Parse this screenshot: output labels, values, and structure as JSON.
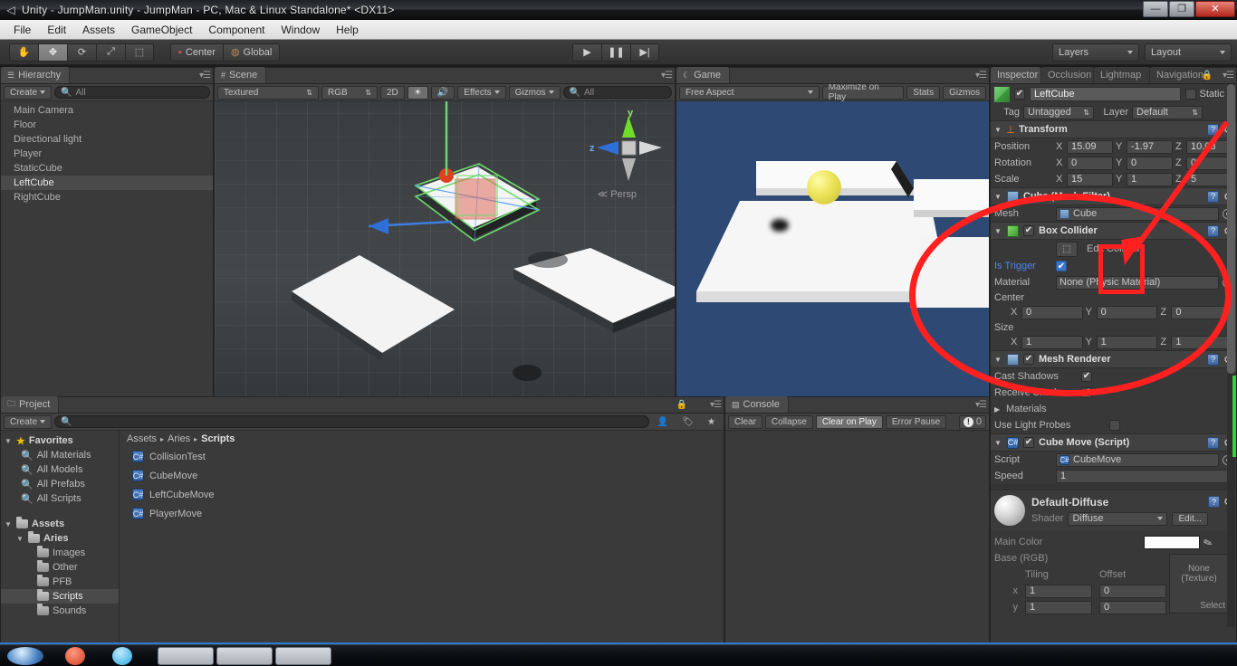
{
  "window": {
    "title": "Unity - JumpMan.unity - JumpMan - PC, Mac & Linux Standalone* <DX11>",
    "minimize": "—",
    "restore": "❐",
    "close": "✕"
  },
  "menubar": {
    "items": [
      "File",
      "Edit",
      "Assets",
      "GameObject",
      "Component",
      "Window",
      "Help"
    ]
  },
  "toolbar": {
    "tools": [
      {
        "name": "hand-tool",
        "glyph": "✋",
        "active": false
      },
      {
        "name": "move-tool",
        "glyph": "✥",
        "active": true
      },
      {
        "name": "rotate-tool",
        "glyph": "⟳",
        "active": false
      },
      {
        "name": "scale-tool",
        "glyph": "⤢",
        "active": false
      },
      {
        "name": "rect-tool",
        "glyph": "⬚",
        "active": false
      }
    ],
    "pivot_label": "Center",
    "space_label": "Global",
    "play": "▶",
    "pause": "❚❚",
    "step": "▶|",
    "layers_label": "Layers",
    "layout_label": "Layout"
  },
  "hierarchy": {
    "tab": "Hierarchy",
    "create_label": "Create",
    "search_placeholder": "All",
    "items": [
      {
        "label": "Main Camera",
        "selected": false
      },
      {
        "label": "Floor",
        "selected": false
      },
      {
        "label": "Directional light",
        "selected": false
      },
      {
        "label": "Player",
        "selected": false
      },
      {
        "label": "StaticCube",
        "selected": false
      },
      {
        "label": "LeftCube",
        "selected": true
      },
      {
        "label": "RightCube",
        "selected": false
      }
    ]
  },
  "scene": {
    "tab": "Scene",
    "draw_mode": "Textured",
    "color_mode": "RGB",
    "two_d": "2D",
    "effects": "Effects",
    "gizmos": "Gizmos",
    "search_placeholder": "All",
    "persp_label": "Persp",
    "axis_y": "y",
    "axis_z": "z"
  },
  "game": {
    "tab": "Game",
    "aspect": "Free Aspect",
    "maximize": "Maximize on Play",
    "stats": "Stats",
    "gizmos": "Gizmos"
  },
  "project": {
    "tab": "Project",
    "create_label": "Create",
    "breadcrumb": [
      "Assets",
      "Aries",
      "Scripts"
    ],
    "favorites_label": "Favorites",
    "favorites": [
      "All Materials",
      "All Models",
      "All Prefabs",
      "All Scripts"
    ],
    "assets_label": "Assets",
    "root_folder": "Aries",
    "folders": [
      {
        "label": "Images",
        "selected": false
      },
      {
        "label": "Other",
        "selected": false
      },
      {
        "label": "PFB",
        "selected": false
      },
      {
        "label": "Scripts",
        "selected": true
      },
      {
        "label": "Sounds",
        "selected": false
      }
    ],
    "assets": [
      "CollisionTest",
      "CubeMove",
      "LeftCubeMove",
      "PlayerMove"
    ],
    "asset_icon": "C#"
  },
  "console": {
    "tab": "Console",
    "clear": "Clear",
    "collapse": "Collapse",
    "clear_on_play": "Clear on Play",
    "error_pause": "Error Pause",
    "error_count": "0"
  },
  "inspector": {
    "tabs": [
      "Inspector",
      "Occlusion",
      "Lightmap",
      "Navigation"
    ],
    "object_name": "LeftCube",
    "object_enabled": true,
    "static_label": "Static",
    "tag_label": "Tag",
    "tag_value": "Untagged",
    "layer_label": "Layer",
    "layer_value": "Default",
    "transform": {
      "title": "Transform",
      "rows": [
        {
          "label": "Position",
          "x": "15.09",
          "y": "-1.97",
          "z": "10.03"
        },
        {
          "label": "Rotation",
          "x": "0",
          "y": "0",
          "z": "0"
        },
        {
          "label": "Scale",
          "x": "15",
          "y": "1",
          "z": "5"
        }
      ]
    },
    "mesh_filter": {
      "title": "Cube (Mesh Filter)",
      "mesh_label": "Mesh",
      "mesh_value": "Cube"
    },
    "box_collider": {
      "title": "Box Collider",
      "enabled": true,
      "edit_collider_label": "Edit Collider",
      "is_trigger_label": "Is Trigger",
      "is_trigger_value": true,
      "material_label": "Material",
      "material_value": "None (Physic Material)",
      "center_label": "Center",
      "center": {
        "x": "0",
        "y": "0",
        "z": "0"
      },
      "size_label": "Size",
      "size": {
        "x": "1",
        "y": "1",
        "z": "1"
      }
    },
    "mesh_renderer": {
      "title": "Mesh Renderer",
      "enabled": true,
      "cast_shadows_label": "Cast Shadows",
      "cast_shadows": true,
      "receive_shadows_label": "Receive Shadows",
      "receive_shadows": true,
      "materials_label": "Materials",
      "use_light_probes_label": "Use Light Probes",
      "use_light_probes": false
    },
    "script_component": {
      "title": "Cube Move (Script)",
      "enabled": true,
      "script_label": "Script",
      "script_value": "CubeMove",
      "speed_label": "Speed",
      "speed_value": "1"
    },
    "material": {
      "title": "Default-Diffuse",
      "shader_label": "Shader",
      "shader_value": "Diffuse",
      "edit_label": "Edit...",
      "main_color_label": "Main Color",
      "base_rgb_label": "Base (RGB)",
      "tiling_label": "Tiling",
      "offset_label": "Offset",
      "tex_none_label": "None",
      "tex_type_label": "(Texture)",
      "select_label": "Select",
      "rows": [
        {
          "axis": "x",
          "tiling": "1",
          "offset": "0"
        },
        {
          "axis": "y",
          "tiling": "1",
          "offset": "0"
        }
      ]
    }
  },
  "annotations": {
    "highlight_color": "#ff2020",
    "ellipse_label": "box-collider-trigger-region",
    "rect_label": "is-trigger-checkbox-highlight",
    "arrow_label": "pointer-to-is-trigger"
  }
}
